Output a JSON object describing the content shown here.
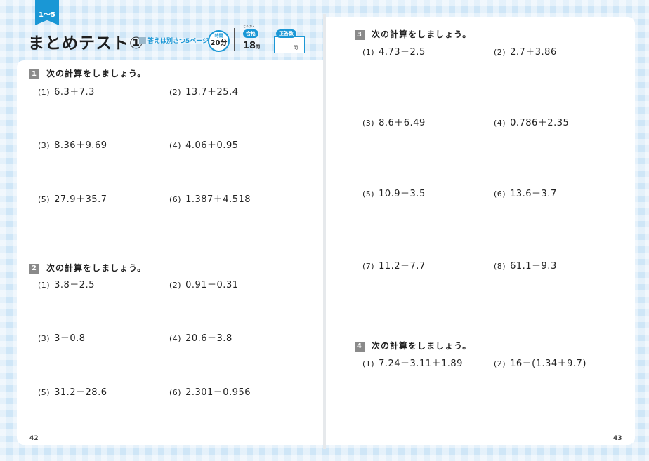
{
  "header": {
    "badge": "1〜5",
    "title": "まとめテスト①",
    "answer_ref": "答えは別さつ5ページ",
    "time_label": "時間",
    "time_value": "20分",
    "pass_ruby": "ごう かく",
    "pass_label": "合格",
    "pass_value": "18",
    "pass_unit": "問",
    "correct_label": "正答数",
    "correct_unit": "問"
  },
  "sections": [
    {
      "number": "1",
      "title": "次の計算をしましょう。",
      "problems": [
        {
          "label": "(1)",
          "expr": "6.3＋7.3"
        },
        {
          "label": "(2)",
          "expr": "13.7＋25.4"
        },
        {
          "label": "(3)",
          "expr": "8.36＋9.69"
        },
        {
          "label": "(4)",
          "expr": "4.06＋0.95"
        },
        {
          "label": "(5)",
          "expr": "27.9＋35.7"
        },
        {
          "label": "(6)",
          "expr": "1.387＋4.518"
        }
      ]
    },
    {
      "number": "2",
      "title": "次の計算をしましょう。",
      "problems": [
        {
          "label": "(1)",
          "expr": "3.8－2.5"
        },
        {
          "label": "(2)",
          "expr": "0.91－0.31"
        },
        {
          "label": "(3)",
          "expr": "3－0.8"
        },
        {
          "label": "(4)",
          "expr": "20.6－3.8"
        },
        {
          "label": "(5)",
          "expr": "31.2－28.6"
        },
        {
          "label": "(6)",
          "expr": "2.301－0.956"
        }
      ]
    },
    {
      "number": "3",
      "title": "次の計算をしましょう。",
      "problems": [
        {
          "label": "(1)",
          "expr": "4.73＋2.5"
        },
        {
          "label": "(2)",
          "expr": "2.7＋3.86"
        },
        {
          "label": "(3)",
          "expr": "8.6＋6.49"
        },
        {
          "label": "(4)",
          "expr": "0.786＋2.35"
        },
        {
          "label": "(5)",
          "expr": "10.9－3.5"
        },
        {
          "label": "(6)",
          "expr": "13.6－3.7"
        },
        {
          "label": "(7)",
          "expr": "11.2－7.7"
        },
        {
          "label": "(8)",
          "expr": "61.1－9.3"
        }
      ]
    },
    {
      "number": "4",
      "title": "次の計算をしましょう。",
      "problems": [
        {
          "label": "(1)",
          "expr": "7.24－3.11＋1.89"
        },
        {
          "label": "(2)",
          "expr": "16－(1.34＋9.7)"
        }
      ]
    }
  ],
  "page_numbers": {
    "left": "42",
    "right": "43"
  }
}
